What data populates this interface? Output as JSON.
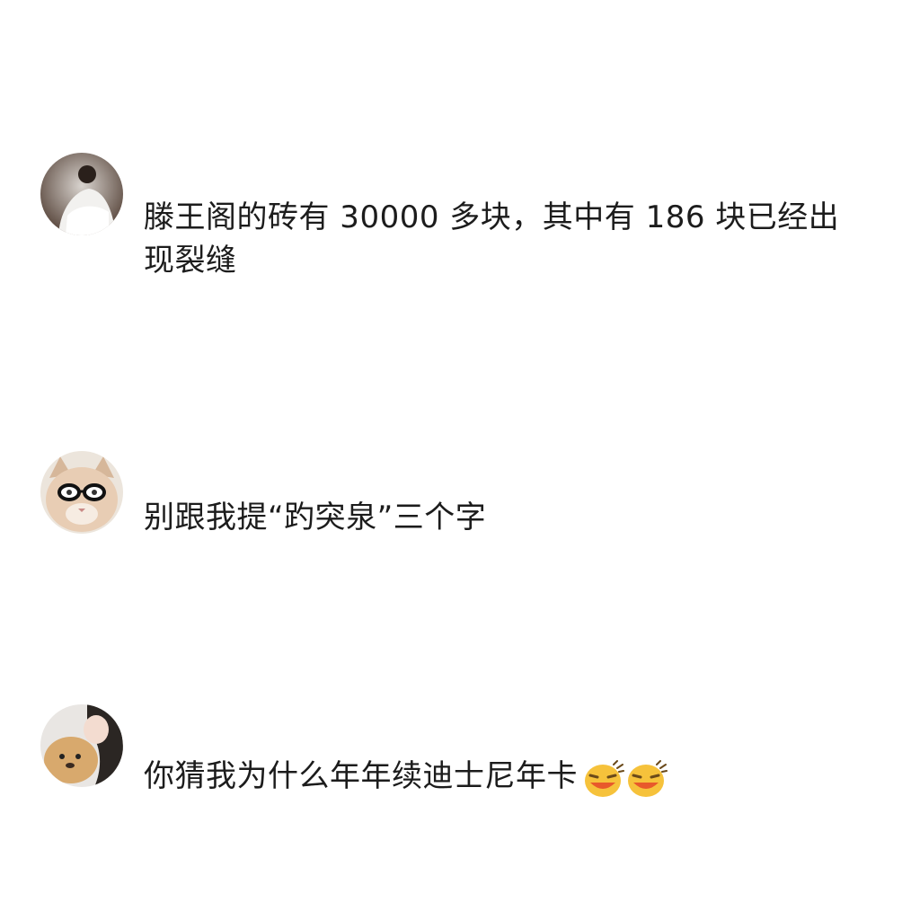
{
  "comments": [
    {
      "avatar_icon": "user-avatar-1",
      "text": "滕王阁的砖有 30000 多块，其中有 186 块已经出现裂缝"
    },
    {
      "avatar_icon": "cat-glasses-avatar",
      "text": "别跟我提“趵突泉”三个字"
    },
    {
      "avatar_icon": "user-avatar-3",
      "text": "你猜我为什么年年续迪士尼年卡",
      "emojis": [
        "laughing-emoji",
        "laughing-emoji"
      ]
    }
  ]
}
